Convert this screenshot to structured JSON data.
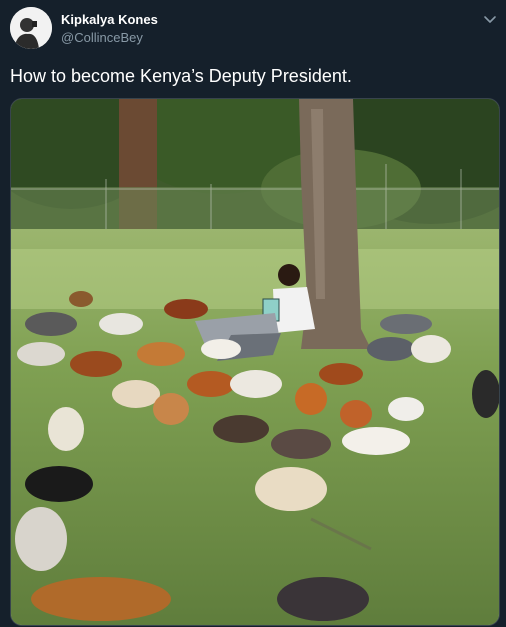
{
  "tweet": {
    "author": {
      "display_name": "Kipkalya Kones",
      "handle": "@CollinceBey",
      "avatar_icon": "profile-photo"
    },
    "text": "How to become Kenya’s Deputy President.",
    "menu_icon": "chevron-down-icon"
  },
  "media": {
    "type": "photo",
    "subject": "man reading a book under a tree surrounded by chickens"
  },
  "colors": {
    "background": "#15202b",
    "primary_text": "#ffffff",
    "secondary_text": "#8899a6",
    "border": "#38444d"
  }
}
